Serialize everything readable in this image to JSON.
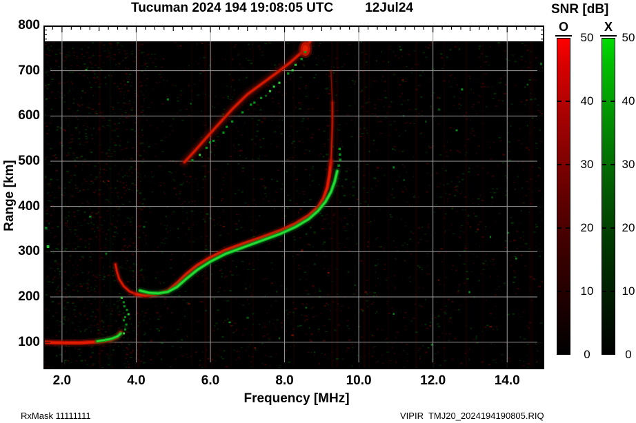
{
  "title": {
    "main": "Tucuman 2024 194 19:08:05 UTC",
    "date": "12Jul24"
  },
  "legend": {
    "title": "SNR [dB]",
    "o_label": "O",
    "x_label": "X",
    "ticks": [
      "50",
      "40",
      "30",
      "20",
      "10",
      "0"
    ],
    "tick_values": [
      50,
      40,
      30,
      20,
      10,
      0
    ],
    "range": [
      0,
      50
    ]
  },
  "axes": {
    "x": {
      "label": "Frequency [MHz]",
      "tick_labels": [
        "2.0",
        "4.0",
        "6.0",
        "8.0",
        "10.0",
        "12.0",
        "14.0"
      ],
      "tick_values": [
        2,
        4,
        6,
        8,
        10,
        12,
        14
      ],
      "minor_step": 0.25
    },
    "y": {
      "label": "Range [km]",
      "tick_labels": [
        "100",
        "200",
        "300",
        "400",
        "500",
        "600",
        "700",
        "800"
      ],
      "tick_values": [
        100,
        200,
        300,
        400,
        500,
        600,
        700,
        800
      ],
      "minor_step": 10
    }
  },
  "footer": {
    "left": "RxMask 11111111",
    "right": "VIPIR  TMJ20_2024194190805.RIQ"
  },
  "chart_data": {
    "type": "heatmap",
    "title": "Tucuman 2024 194 19:08:05 UTC  12Jul24",
    "xlabel": "Frequency [MHz]",
    "ylabel": "Range [km]",
    "xlim": [
      1.5,
      15.0
    ],
    "ylim": [
      40,
      800
    ],
    "raster_top_km": 765,
    "grid": true,
    "legend_position": "right",
    "colorbar": {
      "label": "SNR [dB]",
      "range": [
        0,
        50
      ],
      "o_color": "#ff0000",
      "x_color": "#00dc00"
    },
    "colors": {
      "background": "#000000",
      "grid": "#9e9e9e",
      "o_halo": "rgba(140,18,0,0.30)",
      "o_main": "#ae0e00",
      "o_core": "#e41e00",
      "x_halo": "rgba(0,110,25,0.28)",
      "x_main": "#00a61a",
      "x_core": "#2ede3a"
    },
    "noise": {
      "seed": 1337,
      "count": 3200,
      "red_ratio": 0.56,
      "bright_green": 30,
      "bright_red": 18
    },
    "rfi_stripes": [
      {
        "f": 2.2,
        "w": 2,
        "mode": "X",
        "op": 0.06
      },
      {
        "f": 3.02,
        "w": 3,
        "mode": "O",
        "op": 0.13
      },
      {
        "f": 3.3,
        "w": 3,
        "mode": "X",
        "op": 0.08
      },
      {
        "f": 4.06,
        "w": 4,
        "mode": "O",
        "op": 0.15
      },
      {
        "f": 5.5,
        "w": 2,
        "mode": "O",
        "op": 0.1
      },
      {
        "f": 5.87,
        "w": 3,
        "mode": "O",
        "op": 0.16
      },
      {
        "f": 6.02,
        "w": 3,
        "mode": "O",
        "op": 0.13
      },
      {
        "f": 6.55,
        "w": 2,
        "mode": "O",
        "op": 0.08
      },
      {
        "f": 7.15,
        "w": 2,
        "mode": "O",
        "op": 0.1
      },
      {
        "f": 8.25,
        "w": 2,
        "mode": "O",
        "op": 0.1
      },
      {
        "f": 9.28,
        "w": 3,
        "mode": "O",
        "op": 0.12
      },
      {
        "f": 9.42,
        "w": 3,
        "mode": "O",
        "op": 0.15
      },
      {
        "f": 10.15,
        "w": 3,
        "mode": "O",
        "op": 0.14
      },
      {
        "f": 10.28,
        "w": 2,
        "mode": "O",
        "op": 0.11
      },
      {
        "f": 10.8,
        "w": 2,
        "mode": "O",
        "op": 0.07
      },
      {
        "f": 11.55,
        "w": 3,
        "mode": "O",
        "op": 0.12
      },
      {
        "f": 12.3,
        "w": 2,
        "mode": "O",
        "op": 0.1
      },
      {
        "f": 12.9,
        "w": 3,
        "mode": "O",
        "op": 0.11
      },
      {
        "f": 13.35,
        "w": 2,
        "mode": "O",
        "op": 0.08
      },
      {
        "f": 14.65,
        "w": 6,
        "mode": "O",
        "op": 0.09
      }
    ],
    "traces": [
      {
        "name": "o-low-trace",
        "mode": "O",
        "style": "line",
        "w": 6,
        "points": [
          [
            1.52,
            100
          ],
          [
            1.75,
            99
          ],
          [
            2.1,
            98.5
          ],
          [
            2.5,
            98.5
          ],
          [
            2.85,
            100
          ],
          [
            3.1,
            102
          ],
          [
            3.3,
            105
          ],
          [
            3.48,
            111
          ],
          [
            3.58,
            121
          ]
        ]
      },
      {
        "name": "x-low-trace",
        "mode": "X",
        "style": "line",
        "w": 4.5,
        "points": [
          [
            2.95,
            102
          ],
          [
            3.15,
            104.5
          ],
          [
            3.35,
            108
          ],
          [
            3.5,
            113
          ],
          [
            3.58,
            119
          ]
        ]
      },
      {
        "name": "o-ef-cusp",
        "mode": "O",
        "style": "line",
        "w": 4,
        "points": [
          [
            3.44,
            272
          ],
          [
            3.48,
            256
          ],
          [
            3.54,
            240
          ],
          [
            3.66,
            224
          ],
          [
            3.82,
            212
          ],
          [
            4.0,
            206
          ]
        ]
      },
      {
        "name": "o-main-trace",
        "mode": "O",
        "style": "line",
        "w": 5.5,
        "points": [
          [
            4.0,
            206
          ],
          [
            4.25,
            203
          ],
          [
            4.55,
            206
          ],
          [
            4.85,
            213
          ],
          [
            5.1,
            230
          ],
          [
            5.35,
            250
          ],
          [
            5.65,
            270
          ],
          [
            6.0,
            287
          ],
          [
            6.4,
            303
          ],
          [
            6.9,
            318
          ],
          [
            7.4,
            332
          ],
          [
            7.9,
            347
          ],
          [
            8.3,
            362
          ],
          [
            8.65,
            380
          ],
          [
            8.9,
            398
          ],
          [
            9.05,
            418
          ],
          [
            9.15,
            442
          ],
          [
            9.21,
            470
          ],
          [
            9.25,
            500
          ]
        ]
      },
      {
        "name": "o-asymptote-upper",
        "mode": "O",
        "style": "line",
        "w": 3.5,
        "dim": 0.75,
        "points": [
          [
            9.25,
            495
          ],
          [
            9.27,
            540
          ],
          [
            9.29,
            585
          ],
          [
            9.29,
            630
          ]
        ]
      },
      {
        "name": "o-asymptote-faint",
        "mode": "O",
        "style": "line",
        "w": 2.5,
        "dim": 0.35,
        "points": [
          [
            9.29,
            625
          ],
          [
            9.27,
            665
          ],
          [
            9.25,
            700
          ]
        ]
      },
      {
        "name": "x-main-trace",
        "mode": "X",
        "style": "line",
        "w": 5,
        "points": [
          [
            4.1,
            214
          ],
          [
            4.35,
            209
          ],
          [
            4.6,
            208
          ],
          [
            4.85,
            211
          ],
          [
            5.1,
            222
          ],
          [
            5.35,
            240
          ],
          [
            5.65,
            260
          ],
          [
            6.0,
            278
          ],
          [
            6.4,
            295
          ],
          [
            6.9,
            310
          ],
          [
            7.4,
            325
          ],
          [
            7.9,
            340
          ],
          [
            8.3,
            355
          ],
          [
            8.65,
            372
          ],
          [
            8.9,
            390
          ],
          [
            9.1,
            410
          ],
          [
            9.25,
            432
          ],
          [
            9.35,
            455
          ],
          [
            9.42,
            478
          ]
        ]
      },
      {
        "name": "x-asymptote-dots",
        "mode": "X",
        "style": "dots",
        "size": 3.5,
        "jitter": 4,
        "points": [
          [
            9.45,
            492
          ],
          [
            9.48,
            503
          ],
          [
            9.5,
            516
          ],
          [
            9.47,
            528
          ]
        ]
      },
      {
        "name": "o-second-hop",
        "mode": "O",
        "style": "line",
        "w": 5,
        "dim": 0.85,
        "halo2_w": 16,
        "points": [
          [
            5.3,
            498
          ],
          [
            5.55,
            520
          ],
          [
            5.85,
            548
          ],
          [
            6.2,
            580
          ],
          [
            6.6,
            616
          ],
          [
            7.0,
            648
          ],
          [
            7.4,
            672
          ],
          [
            7.8,
            696
          ],
          [
            8.15,
            718
          ],
          [
            8.45,
            740
          ],
          [
            8.6,
            755
          ],
          [
            8.68,
            764
          ]
        ]
      },
      {
        "name": "o-second-hop-blob",
        "mode": "O",
        "style": "blob",
        "rx": 7,
        "ry": 10,
        "points": [
          [
            8.56,
            748
          ]
        ]
      },
      {
        "name": "x-second-hop-dots",
        "mode": "X",
        "style": "dots",
        "size": 3.2,
        "jitter": 7,
        "points": [
          [
            5.5,
            505
          ],
          [
            5.7,
            515
          ],
          [
            5.9,
            530
          ],
          [
            6.0,
            538
          ],
          [
            6.1,
            545
          ],
          [
            6.35,
            565
          ],
          [
            6.45,
            575
          ],
          [
            6.6,
            585
          ],
          [
            6.85,
            605
          ],
          [
            7.1,
            622
          ],
          [
            7.2,
            630
          ],
          [
            7.35,
            640
          ],
          [
            7.6,
            658
          ],
          [
            7.7,
            665
          ],
          [
            7.85,
            676
          ],
          [
            8.1,
            695
          ],
          [
            8.2,
            703
          ],
          [
            8.3,
            712
          ],
          [
            8.45,
            728
          ],
          [
            8.55,
            742
          ]
        ]
      },
      {
        "name": "x-spike-dots",
        "mode": "X",
        "style": "dots",
        "size": 3,
        "jitter": 5,
        "points": [
          [
            3.62,
            196
          ],
          [
            3.66,
            188
          ],
          [
            3.7,
            180
          ],
          [
            3.74,
            171
          ],
          [
            3.78,
            163
          ],
          [
            3.72,
            155
          ],
          [
            3.68,
            147
          ],
          [
            3.75,
            139
          ],
          [
            3.7,
            130
          ],
          [
            3.65,
            121
          ]
        ]
      },
      {
        "name": "x-left-edge-dashes",
        "mode": "X",
        "style": "dots",
        "size": 4,
        "jitter": 2,
        "points": [
          [
            1.58,
            352
          ],
          [
            1.62,
            312
          ]
        ]
      }
    ]
  }
}
